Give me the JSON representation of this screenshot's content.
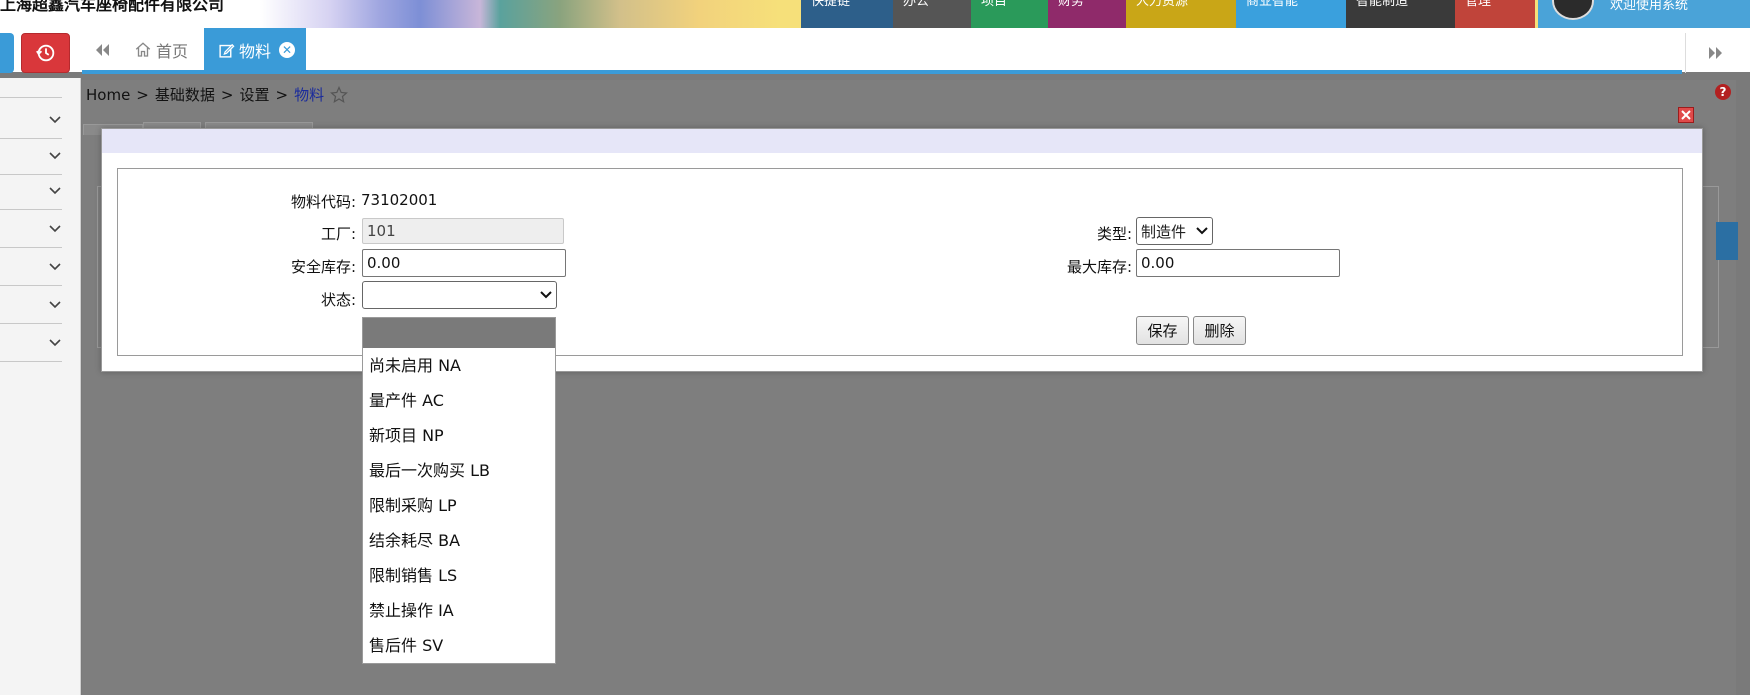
{
  "header": {
    "company_name": "上海超鑫汽车座椅配件有限公司",
    "nav_items": [
      {
        "label": "快捷链",
        "color": "#2d5f8a"
      },
      {
        "label": "办公",
        "color": "#555555"
      },
      {
        "label": "项目",
        "color": "#2a9a5a"
      },
      {
        "label": "财务",
        "color": "#8f2a6a"
      },
      {
        "label": "人力资源",
        "color": "#c9a617"
      },
      {
        "label": "商业智能",
        "color": "#3aa0dd"
      },
      {
        "label": "智能制造",
        "color": "#3a3a3a"
      },
      {
        "label": "管理",
        "color": "#c0443a"
      }
    ],
    "user_name": "欢迎使用系统"
  },
  "tabs": {
    "home_label": "首页",
    "active_label": "物料"
  },
  "breadcrumb": {
    "items": [
      "Home",
      "基础数据",
      "设置"
    ],
    "current": "物料",
    "separator": ">"
  },
  "form": {
    "material_code_label": "物料代码:",
    "material_code_value": "73102001",
    "factory_label": "工厂:",
    "factory_value": "101",
    "safety_stock_label": "安全库存:",
    "safety_stock_value": "0.00",
    "status_label": "状态:",
    "status_value": "",
    "type_label": "类型:",
    "type_value": "制造件",
    "max_stock_label": "最大库存:",
    "max_stock_value": "0.00",
    "save_label": "保存",
    "delete_label": "删除"
  },
  "status_dropdown": {
    "options": [
      "",
      "尚未启用 NA",
      "量产件 AC",
      "新项目 NP",
      "最后一次购买 LB",
      "限制采购 LP",
      "结余耗尽 BA",
      "限制销售 LS",
      "禁止操作 IA",
      "售后件 SV"
    ]
  }
}
